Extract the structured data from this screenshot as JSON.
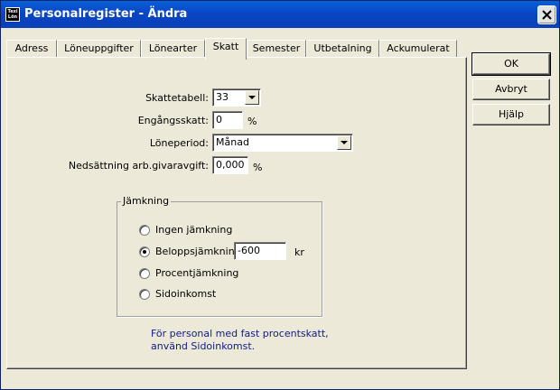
{
  "window": {
    "title": "Personalregister - Ändra",
    "icon_text": [
      "Texi",
      "Lön"
    ]
  },
  "tabs": [
    "Adress",
    "Löneuppgifter",
    "Lönearter",
    "Skatt",
    "Semester",
    "Utbetalning",
    "Ackumulerat"
  ],
  "active_tab": "Skatt",
  "form": {
    "skattetabell_label": "Skattetabell:",
    "skattetabell_value": "33",
    "engangsskatt_label": "Engångsskatt:",
    "engangsskatt_value": "0",
    "engangsskatt_unit": "%",
    "loneperiod_label": "Löneperiod:",
    "loneperiod_value": "Månad",
    "nedsattning_label": "Nedsättning arb.givaravgift:",
    "nedsattning_value": "0,000",
    "nedsattning_unit": "%"
  },
  "jamkning": {
    "title": "Jämkning",
    "options": [
      "Ingen jämkning",
      "Beloppsjämkning",
      "Procentjämkning",
      "Sidoinkomst"
    ],
    "selected": "Beloppsjämkning",
    "amount_value": "-600",
    "amount_unit": "kr"
  },
  "note": {
    "line1": "För personal med fast procentskatt,",
    "line2": "använd Sidoinkomst."
  },
  "buttons": {
    "ok": "OK",
    "cancel": "Avbryt",
    "help": "Hjälp"
  },
  "icons": {
    "close": "close-icon",
    "dropdown": "chevron-down-icon",
    "app": "app-icon"
  }
}
